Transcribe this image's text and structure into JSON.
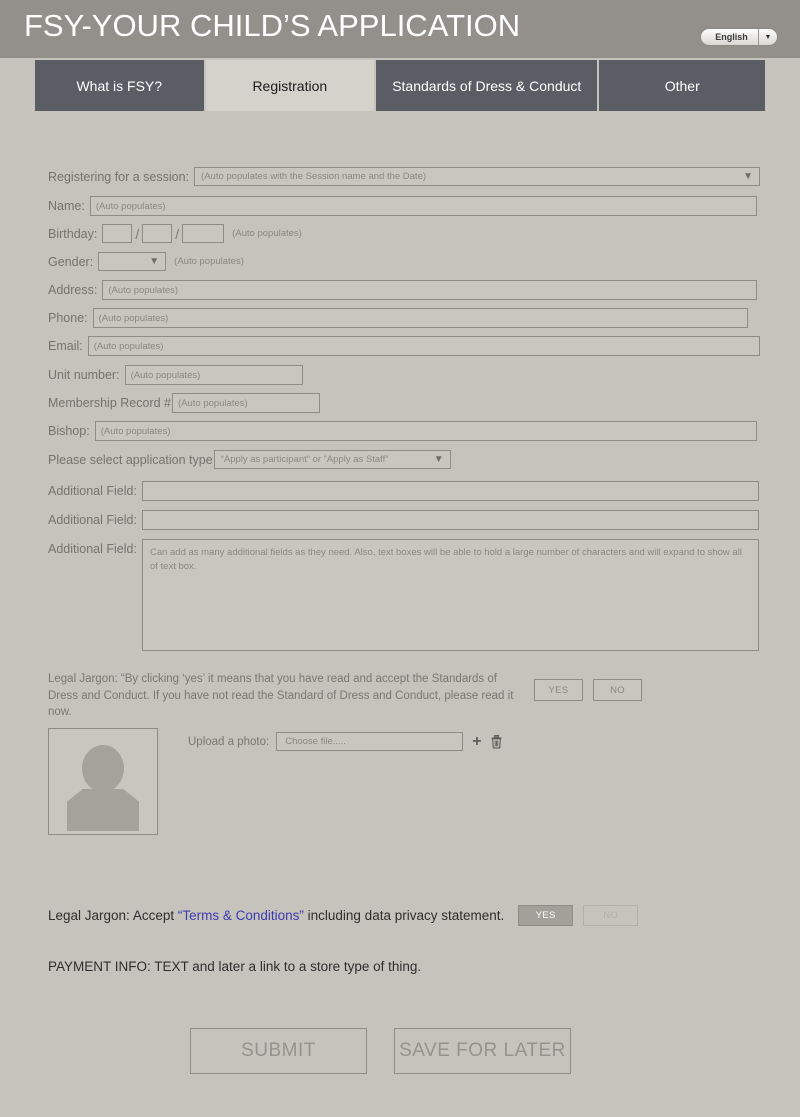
{
  "header": {
    "title": "FSY-YOUR CHILD’S APPLICATION",
    "language": "English",
    "language_caret": "▼"
  },
  "tabs": [
    {
      "label": "What is FSY?",
      "active": false
    },
    {
      "label": "Registration",
      "active": true
    },
    {
      "label": "Standards of Dress  & Conduct",
      "active": false
    },
    {
      "label": "Other",
      "active": false
    }
  ],
  "form": {
    "session": {
      "label": "Registering for a session:",
      "value": "(Auto populates with the Session name and the Date)",
      "caret": "▼"
    },
    "name": {
      "label": "Name:",
      "value": "(Auto populates)"
    },
    "birthday": {
      "label": "Birthday:",
      "sep": "/",
      "month": "",
      "day": "",
      "year": "",
      "hint": "(Auto populates)"
    },
    "gender": {
      "label": "Gender:",
      "value": "",
      "caret": "▼",
      "hint": "(Auto populates)"
    },
    "address": {
      "label": "Address:",
      "value": "(Auto populates)"
    },
    "phone": {
      "label": "Phone:",
      "value": "(Auto populates)"
    },
    "email": {
      "label": "Email:",
      "value": "(Auto populates)"
    },
    "unit_number": {
      "label": "Unit number:",
      "value": "(Auto populates)"
    },
    "membership_record": {
      "label": "Membership Record #",
      "value": "(Auto populates)"
    },
    "bishop": {
      "label": "Bishop:",
      "value": "(Auto populates)"
    },
    "application_type": {
      "label": "Please select application type",
      "value": "“Apply as participant” or “Apply as Staff”",
      "caret": "▼"
    },
    "additional_field_1": {
      "label": "Additional Field:",
      "value": ""
    },
    "additional_field_2": {
      "label": "Additional Field:",
      "value": ""
    },
    "additional_field_3": {
      "label": "Additional Field:",
      "value": "Can add as many additional fields as they need. Also, text boxes will be able to hold a large number of characters and will expand to show all of text box."
    }
  },
  "legal_dress": {
    "text": "Legal Jargon: “By clicking ‘yes’ it means that you have read and accept the Standards of Dress and Conduct. If you have not read the Standard of Dress and Conduct, please read it now.",
    "yes_label": "YES",
    "no_label": "NO"
  },
  "photo": {
    "upload_label": "Upload a photo:",
    "choose_file": "Choose file.....",
    "add_icon": "+",
    "avatar_alt": "person-placeholder"
  },
  "terms": {
    "prefix": "Legal Jargon: Accept ",
    "link": "“Terms & Conditions”",
    "suffix": " including data privacy statement.",
    "yes_label": "YES",
    "no_label": "NO"
  },
  "payment": {
    "text": "PAYMENT INFO:   TEXT and later a link to a store type of thing."
  },
  "actions": {
    "submit": "SUBMIT",
    "save": "SAVE FOR LATER"
  },
  "colors": {
    "page_bg": "#c6c3bc",
    "header_bg": "#93908b",
    "tab_bg": "#5b5d64",
    "tab_active_bg": "#d5d2cb",
    "field_border": "#8f8c86",
    "label_text": "#76736d",
    "link": "#3b3bb0",
    "selected_btn": "#a3a099"
  }
}
